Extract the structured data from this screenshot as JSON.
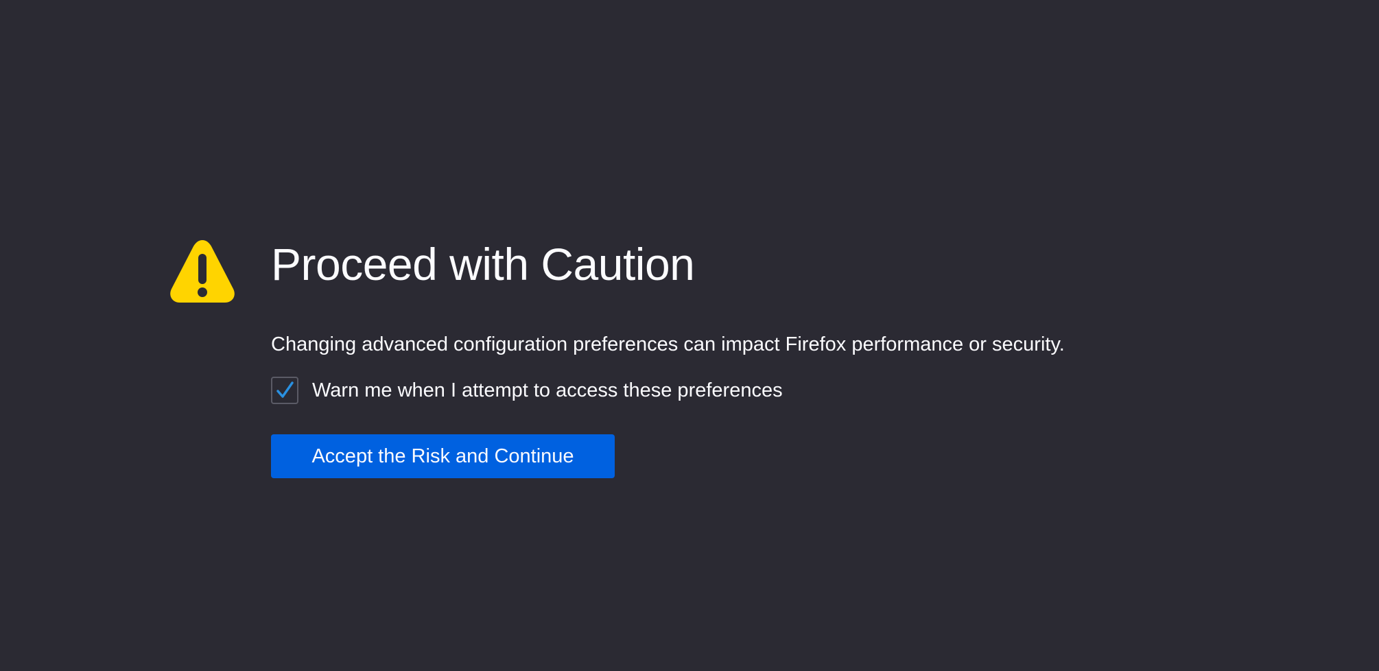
{
  "page": {
    "background_color": "#2b2a33",
    "warning_icon": {
      "name": "warning-triangle-icon",
      "color": "#ffd400",
      "glyph_color": "#2b2a33"
    },
    "title": "Proceed with Caution",
    "description": "Changing advanced configuration preferences can impact Firefox performance or security.",
    "warn_checkbox": {
      "label": "Warn me when I attempt to access these preferences",
      "checked": true,
      "check_color": "#2a90e0"
    },
    "accept_button": {
      "label": "Accept the Risk and Continue",
      "color": "#0061e0"
    }
  }
}
